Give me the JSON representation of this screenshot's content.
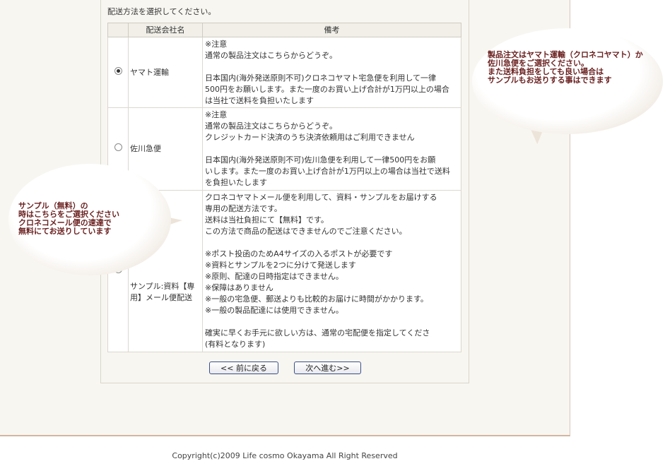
{
  "instruction": "配送方法を選択してください。",
  "table": {
    "headers": [
      "",
      "配送会社名",
      "備考"
    ],
    "rows": [
      {
        "selected": true,
        "name": "ヤマト運輸",
        "notes": [
          "※注意",
          "通常の製品注文はこちらからどうぞ。",
          "",
          "日本国内(海外発送原則不可)クロネコヤマト宅急便を利用して一律",
          "500円をお願いします。また一度のお買い上げ合計が1万円以上の場合",
          "は当社で送料を負担いたします"
        ]
      },
      {
        "selected": false,
        "name": "佐川急便",
        "notes": [
          "※注意",
          "通常の製品注文はこちらからどうぞ。",
          "クレジットカード決済のうち決済依頼用はご利用できません",
          "",
          "日本国内(海外発送原則不可)佐川急便を利用して一律500円をお願",
          "いします。また一度のお買い上げ合計が1万円以上の場合は当社で送料",
          "を負担いたします"
        ]
      },
      {
        "selected": false,
        "name": "サンプル:資料【専用】メール便配送",
        "notes": [
          "クロネコヤマトメール便を利用して、資料・サンプルをお届けする",
          "専用の配送方法です。",
          "送料は当社負担にて【無料】です。",
          "この方法で商品の配送はできませんのでご注意ください。",
          "",
          "※ポスト投函のためA4サイズの入るポストが必要です",
          "※資料とサンプルを2つに分けて発送します",
          "※原則、配達の日時指定はできません。",
          "※保障はありません",
          "※一般の宅急便、郵送よりも比較的お届けに時間がかかります。",
          "※一般の製品配達には使用できません。",
          "",
          "確実に早くお手元に欲しい方は、通常の宅配便を指定してくださ",
          "(有料となります)"
        ]
      }
    ]
  },
  "buttons": {
    "back": "<< 前に戻る",
    "next": "次へ進む>>"
  },
  "bubble_right": [
    "製品注文はヤマト運輸（クロネコヤマト）か",
    "佐川急便をご選択ください。",
    "また送料負担をしても良い場合は",
    "サンプルもお送りする事はできます"
  ],
  "bubble_left": [
    "サンプル（無料）の",
    "時はこちらをご選択ください",
    "クロネコメール便の速達で",
    "無料にてお送りしています"
  ],
  "footer": "Copyright(c)2009 Life cosmo Okayama All Right Reserved",
  "colors": {
    "page_bg": "#f8f6f1",
    "bubble_text": "#6a1f1f",
    "button_border": "#3a4f8a"
  }
}
